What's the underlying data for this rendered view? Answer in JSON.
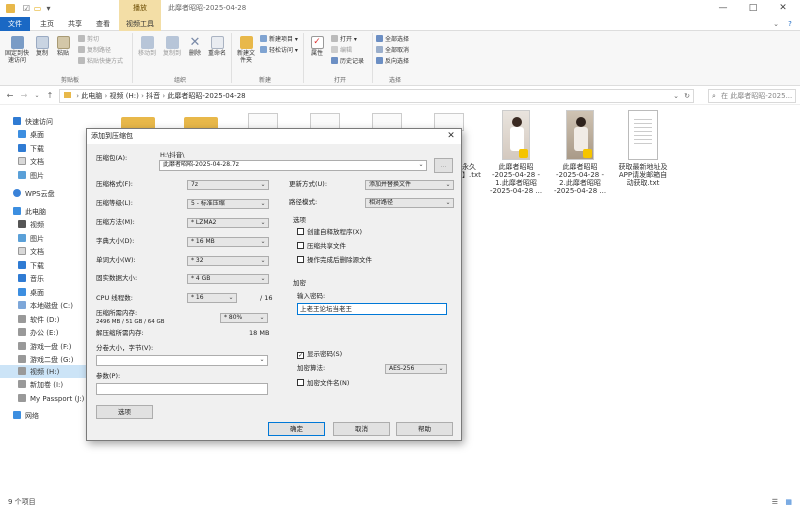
{
  "window": {
    "title": "此靡者昭昭-2025-04-28",
    "context_tab_top": "播放"
  },
  "ribbon_tabs": {
    "file": "文件",
    "home": "主页",
    "share": "共享",
    "view": "查看",
    "video_tools": "视频工具"
  },
  "ribbon": {
    "pin_quick_access": "固定到快速访问",
    "copy": "复制",
    "paste": "粘贴",
    "cut": "剪切",
    "copy_path": "复制路径",
    "paste_shortcut": "粘贴快捷方式",
    "clipboard_group": "剪贴板",
    "move_to": "移动到",
    "copy_to": "复制到",
    "delete": "删除",
    "rename": "重命名",
    "organize_group": "组织",
    "new_folder": "新建文件夹",
    "new_item": "新建项目",
    "easy_access": "轻松访问",
    "new_group": "新建",
    "properties": "属性",
    "open": "打开",
    "edit": "编辑",
    "history": "历史记录",
    "open_group": "打开",
    "select_all": "全部选择",
    "select_none": "全部取消",
    "invert_selection": "反向选择",
    "select_group": "选择"
  },
  "address": {
    "crumbs": [
      "此电脑",
      "视频 (H:)",
      "抖音",
      "此靡者昭昭-2025-04-28"
    ],
    "search_placeholder": "在 此靡者昭昭-2025..."
  },
  "nav_pane": {
    "items": [
      "快速访问",
      "桌面",
      "下载",
      "文档",
      "图片",
      "WPS云盘",
      "此电脑",
      "视频",
      "图片",
      "文档",
      "下载",
      "音乐",
      "桌面",
      "本地磁盘 (C:)",
      "软件 (D:)",
      "办公 (E:)",
      "游戏一盘 (F:)",
      "游戏二盘 (G:)",
      "视频 (H:)",
      "新加卷 (I:)",
      "My Passport (J:)",
      "网络"
    ]
  },
  "files": [
    {
      "name": "此靡者昭昭\n-2025-04-28 -\n1.此靡者昭昭\n-2025-04-28 ..."
    },
    {
      "name": "此靡者昭昭\n-2025-04-28 -\n2.此靡者昭昭\n-2025-04-28 ..."
    },
    {
      "name": "获取最新地址及\nAPP请发邮箱自\n动获取.txt"
    },
    {
      "name": "永久\n】.txt"
    }
  ],
  "status": {
    "count": "9 个项目"
  },
  "dialog": {
    "title": "添加到压缩包",
    "archive_label": "压缩包(A):",
    "archive_folder": "H:\\抖音\\",
    "archive_name": "此靡者昭昭-2025-04-28.7z",
    "browse": "...",
    "format_label": "压缩格式(F):",
    "format_value": "7z",
    "level_label": "压缩等级(L):",
    "level_value": "5 - 标准压缩",
    "method_label": "压缩方法(M):",
    "method_value": "* LZMA2",
    "dict_label": "字典大小(D):",
    "dict_value": "* 16 MB",
    "word_label": "单词大小(W):",
    "word_value": "* 32",
    "solid_label": "固实数据大小:",
    "solid_value": "* 4 GB",
    "threads_label": "CPU 线程数:",
    "threads_value": "* 16",
    "threads_total": "/ 16",
    "mem_comp_label": "压缩所需内存:",
    "mem_comp_detail": "2496 MB / 51 GB / 64 GB",
    "mem_percent": "* 80%",
    "mem_comp_value": "2496 MB",
    "mem_decomp_label": "解压缩所需内存:",
    "mem_decomp_value": "18 MB",
    "split_label": "分卷大小，字节(V):",
    "params_label": "参数(P):",
    "options_btn": "选项",
    "update_label": "更新方式(U):",
    "update_value": "添加并替换文件",
    "path_label": "路径模式:",
    "path_value": "相对路径",
    "options_group": "选项",
    "opt_sfx": "创建自释放程序(X)",
    "opt_shared": "压缩共享文件",
    "opt_delete": "操作完成后删除源文件",
    "encrypt_group": "加密",
    "password_label": "输入密码:",
    "password_value": "上老王论坛当老王",
    "show_password": "显示密码(S)",
    "enc_method_label": "加密算法:",
    "enc_method_value": "AES-256",
    "encrypt_names": "加密文件名(N)",
    "ok": "确定",
    "cancel": "取消",
    "help": "帮助"
  }
}
